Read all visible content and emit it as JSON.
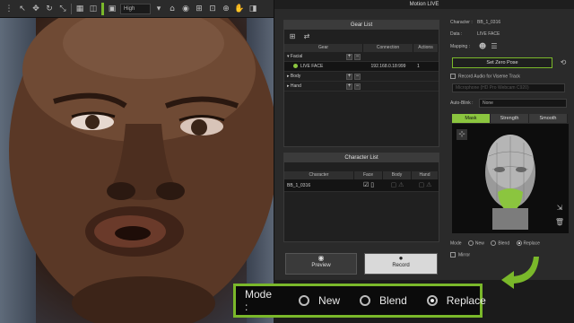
{
  "toolbar": {
    "quality_select": "High"
  },
  "window": {
    "title": "Motion LIVE"
  },
  "gear_list": {
    "title": "Gear List",
    "columns": [
      "Gear",
      "Connection",
      "Actions"
    ],
    "rows": [
      {
        "name": "Facial",
        "connection": "",
        "actions": ""
      },
      {
        "name": "LIVE FACE",
        "connection": "192.168.0.18:999",
        "actions": "1"
      },
      {
        "name": "Body",
        "connection": "",
        "actions": ""
      },
      {
        "name": "Hand",
        "connection": "",
        "actions": ""
      }
    ]
  },
  "character_list": {
    "title": "Character List",
    "columns": [
      "Character",
      "Face",
      "Body",
      "Hand"
    ],
    "rows": [
      {
        "name": "BB_1_0316"
      }
    ]
  },
  "buttons": {
    "preview": "Preview",
    "record": "Record"
  },
  "right": {
    "character_label": "Character :",
    "character_value": "BB_1_0316",
    "data_label": "Data :",
    "data_value": "LIVE FACE",
    "mapping_label": "Mapping :",
    "set_zero_pose": "Set Zero Pose",
    "record_audio_label": "Record Audio for Viseme Track",
    "microphone": "Microphone (HD Pro Webcam C920)",
    "auto_blink_label": "Auto-Blink :",
    "auto_blink_value": "None",
    "tabs": [
      "Mask",
      "Strength",
      "Smooth"
    ],
    "mode_label": "Mode",
    "mode_options": [
      "New",
      "Blend",
      "Replace"
    ],
    "mirror_label": "Mirror"
  },
  "mode_highlight": {
    "label": "Mode :",
    "options": [
      "New",
      "Blend",
      "Replace"
    ],
    "selected": "Replace"
  },
  "colors": {
    "accent": "#7ab82a",
    "mask_green": "#8bc53f"
  }
}
